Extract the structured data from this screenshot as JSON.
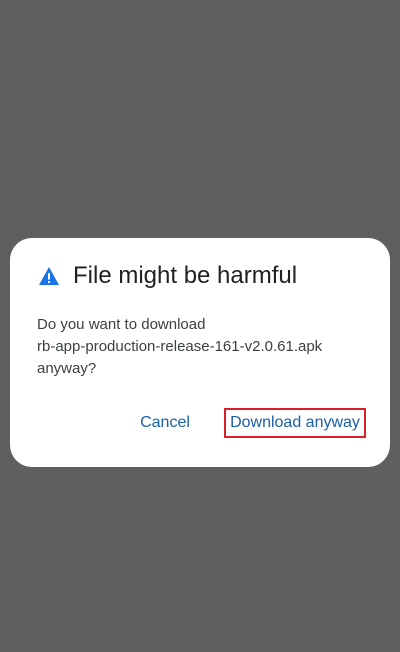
{
  "dialog": {
    "title": "File might be harmful",
    "message_lines": [
      "Do you want to download",
      "rb-app-production-release-161-v2.0.61.apk",
      "anyway?"
    ],
    "icon": "warning-triangle-icon",
    "cancel_label": "Cancel",
    "download_label": "Download anyway"
  },
  "colors": {
    "scrim": "#5f5f5f",
    "dialog_bg": "#ffffff",
    "icon": "#1a73e8",
    "button_text": "#1a5fa8",
    "highlight_border": "#d6202a"
  }
}
